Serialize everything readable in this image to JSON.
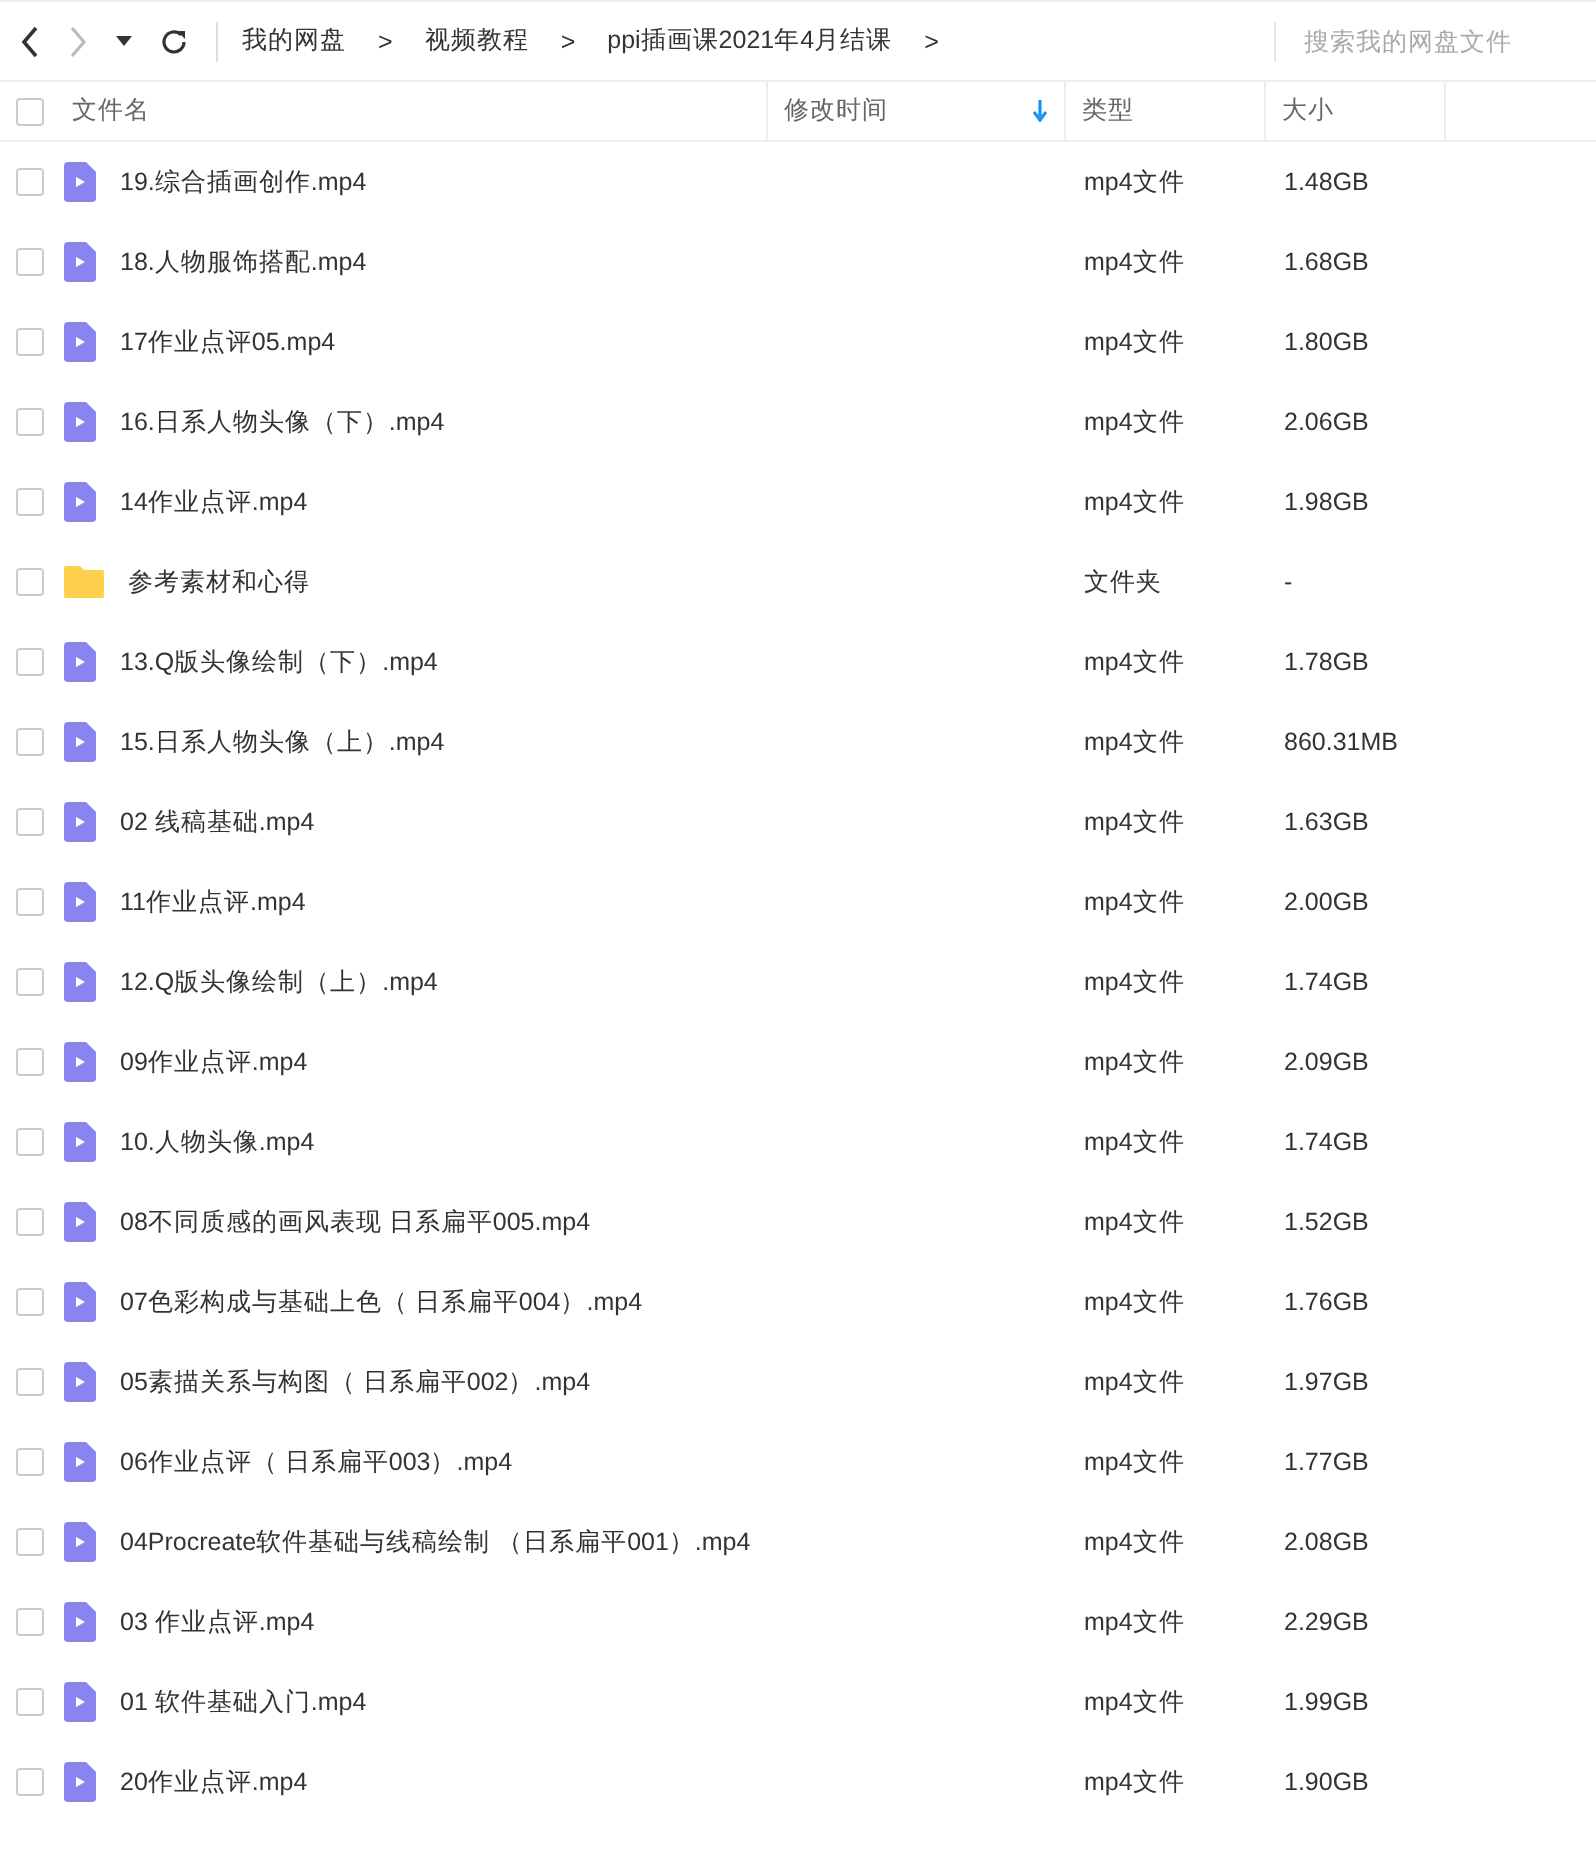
{
  "breadcrumb": [
    {
      "label": "我的网盘",
      "separator": ">"
    },
    {
      "label": "视频教程",
      "separator": ">"
    },
    {
      "label": "ppi插画课2021年4月结课",
      "separator": ">"
    }
  ],
  "search": {
    "placeholder": "搜索我的网盘文件"
  },
  "columns": [
    {
      "label": "文件名",
      "sorted": false
    },
    {
      "label": "修改时间",
      "sorted": true
    },
    {
      "label": "类型",
      "sorted": false
    },
    {
      "label": "大小",
      "sorted": false
    }
  ],
  "select_all": {
    "checked": false
  },
  "rows": [
    {
      "kind": "video",
      "name": "19.综合插画创作.mp4",
      "type": "mp4文件",
      "size": "1.48GB",
      "checked": false
    },
    {
      "kind": "video",
      "name": "18.人物服饰搭配.mp4",
      "type": "mp4文件",
      "size": "1.68GB",
      "checked": false
    },
    {
      "kind": "video",
      "name": "17作业点评05.mp4",
      "type": "mp4文件",
      "size": "1.80GB",
      "checked": false
    },
    {
      "kind": "video",
      "name": "16.日系人物头像（下）.mp4",
      "type": "mp4文件",
      "size": "2.06GB",
      "checked": false
    },
    {
      "kind": "video",
      "name": "14作业点评.mp4",
      "type": "mp4文件",
      "size": "1.98GB",
      "checked": false
    },
    {
      "kind": "folder",
      "name": "参考素材和心得",
      "type": "文件夹",
      "size": "-",
      "checked": false
    },
    {
      "kind": "video",
      "name": "13.Q版头像绘制（下）.mp4",
      "type": "mp4文件",
      "size": "1.78GB",
      "checked": false
    },
    {
      "kind": "video",
      "name": "15.日系人物头像（上）.mp4",
      "type": "mp4文件",
      "size": "860.31MB",
      "checked": false
    },
    {
      "kind": "video",
      "name": "02 线稿基础.mp4",
      "type": "mp4文件",
      "size": "1.63GB",
      "checked": false
    },
    {
      "kind": "video",
      "name": "11作业点评.mp4",
      "type": "mp4文件",
      "size": "2.00GB",
      "checked": false
    },
    {
      "kind": "video",
      "name": "12.Q版头像绘制（上）.mp4",
      "type": "mp4文件",
      "size": "1.74GB",
      "checked": false
    },
    {
      "kind": "video",
      "name": "09作业点评.mp4",
      "type": "mp4文件",
      "size": "2.09GB",
      "checked": false
    },
    {
      "kind": "video",
      "name": "10.人物头像.mp4",
      "type": "mp4文件",
      "size": "1.74GB",
      "checked": false
    },
    {
      "kind": "video",
      "name": "08不同质感的画风表现 日系扁平005.mp4",
      "type": "mp4文件",
      "size": "1.52GB",
      "checked": false
    },
    {
      "kind": "video",
      "name": "07色彩构成与基础上色（ 日系扁平004）.mp4",
      "type": "mp4文件",
      "size": "1.76GB",
      "checked": false
    },
    {
      "kind": "video",
      "name": "05素描关系与构图（ 日系扁平002）.mp4",
      "type": "mp4文件",
      "size": "1.97GB",
      "checked": false
    },
    {
      "kind": "video",
      "name": "06作业点评（ 日系扁平003）.mp4",
      "type": "mp4文件",
      "size": "1.77GB",
      "checked": false
    },
    {
      "kind": "video",
      "name": "04Procreate软件基础与线稿绘制 （日系扁平001）.mp4",
      "type": "mp4文件",
      "size": "2.08GB",
      "checked": false
    },
    {
      "kind": "video",
      "name": "03 作业点评.mp4",
      "type": "mp4文件",
      "size": "2.29GB",
      "checked": false
    },
    {
      "kind": "video",
      "name": "01 软件基础入门.mp4",
      "type": "mp4文件",
      "size": "1.99GB",
      "checked": false
    },
    {
      "kind": "video",
      "name": "20作业点评.mp4",
      "type": "mp4文件",
      "size": "1.90GB",
      "checked": false
    }
  ]
}
